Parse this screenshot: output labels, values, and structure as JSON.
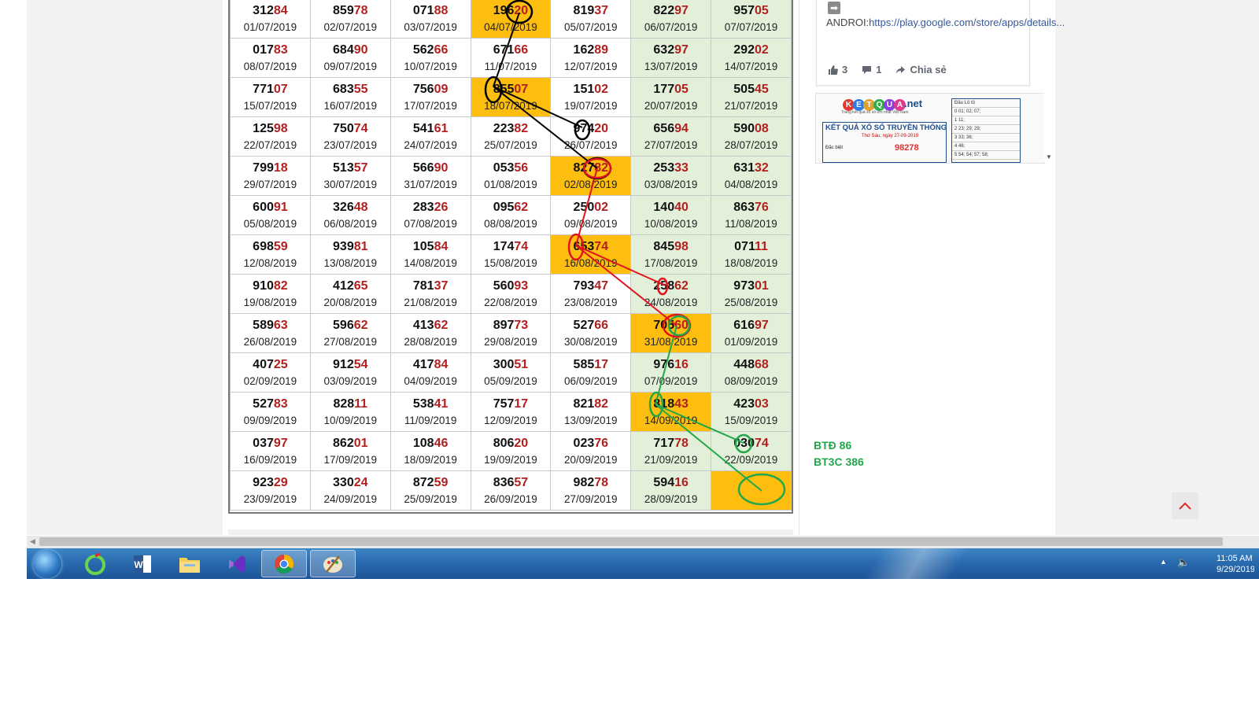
{
  "results": {
    "rows": [
      [
        {
          "head": "312",
          "tail": "84",
          "date": "01/07/2019"
        },
        {
          "head": "859",
          "tail": "78",
          "date": "02/07/2019"
        },
        {
          "head": "071",
          "tail": "88",
          "date": "03/07/2019"
        },
        {
          "head": "196",
          "tail": "20",
          "date": "04/07/2019"
        },
        {
          "head": "819",
          "tail": "37",
          "date": "05/07/2019"
        },
        {
          "head": "822",
          "tail": "97",
          "date": "06/07/2019"
        },
        {
          "head": "957",
          "tail": "05",
          "date": "07/07/2019"
        }
      ],
      [
        {
          "head": "017",
          "tail": "83",
          "date": "08/07/2019"
        },
        {
          "head": "684",
          "tail": "90",
          "date": "09/07/2019"
        },
        {
          "head": "562",
          "tail": "66",
          "date": "10/07/2019"
        },
        {
          "head": "671",
          "tail": "66",
          "date": "11/07/2019"
        },
        {
          "head": "162",
          "tail": "89",
          "date": "12/07/2019"
        },
        {
          "head": "632",
          "tail": "97",
          "date": "13/07/2019"
        },
        {
          "head": "292",
          "tail": "02",
          "date": "14/07/2019"
        }
      ],
      [
        {
          "head": "771",
          "tail": "07",
          "date": "15/07/2019"
        },
        {
          "head": "683",
          "tail": "55",
          "date": "16/07/2019"
        },
        {
          "head": "756",
          "tail": "09",
          "date": "17/07/2019"
        },
        {
          "head": "855",
          "tail": "07",
          "date": "18/07/2019"
        },
        {
          "head": "151",
          "tail": "02",
          "date": "19/07/2019"
        },
        {
          "head": "177",
          "tail": "05",
          "date": "20/07/2019"
        },
        {
          "head": "505",
          "tail": "45",
          "date": "21/07/2019"
        }
      ],
      [
        {
          "head": "125",
          "tail": "98",
          "date": "22/07/2019"
        },
        {
          "head": "750",
          "tail": "74",
          "date": "23/07/2019"
        },
        {
          "head": "541",
          "tail": "61",
          "date": "24/07/2019"
        },
        {
          "head": "223",
          "tail": "82",
          "date": "25/07/2019"
        },
        {
          "head": "974",
          "tail": "20",
          "date": "26/07/2019"
        },
        {
          "head": "656",
          "tail": "94",
          "date": "27/07/2019"
        },
        {
          "head": "590",
          "tail": "08",
          "date": "28/07/2019"
        }
      ],
      [
        {
          "head": "799",
          "tail": "18",
          "date": "29/07/2019"
        },
        {
          "head": "513",
          "tail": "57",
          "date": "30/07/2019"
        },
        {
          "head": "566",
          "tail": "90",
          "date": "31/07/2019"
        },
        {
          "head": "053",
          "tail": "56",
          "date": "01/08/2019"
        },
        {
          "head": "827",
          "tail": "82",
          "date": "02/08/2019"
        },
        {
          "head": "253",
          "tail": "33",
          "date": "03/08/2019"
        },
        {
          "head": "631",
          "tail": "32",
          "date": "04/08/2019"
        }
      ],
      [
        {
          "head": "600",
          "tail": "91",
          "date": "05/08/2019"
        },
        {
          "head": "326",
          "tail": "48",
          "date": "06/08/2019"
        },
        {
          "head": "283",
          "tail": "26",
          "date": "07/08/2019"
        },
        {
          "head": "095",
          "tail": "62",
          "date": "08/08/2019"
        },
        {
          "head": "250",
          "tail": "02",
          "date": "09/08/2019"
        },
        {
          "head": "140",
          "tail": "40",
          "date": "10/08/2019"
        },
        {
          "head": "863",
          "tail": "76",
          "date": "11/08/2019"
        }
      ],
      [
        {
          "head": "698",
          "tail": "59",
          "date": "12/08/2019"
        },
        {
          "head": "939",
          "tail": "81",
          "date": "13/08/2019"
        },
        {
          "head": "105",
          "tail": "84",
          "date": "14/08/2019"
        },
        {
          "head": "174",
          "tail": "74",
          "date": "15/08/2019"
        },
        {
          "head": "653",
          "tail": "74",
          "date": "16/08/2019"
        },
        {
          "head": "845",
          "tail": "98",
          "date": "17/08/2019"
        },
        {
          "head": "071",
          "tail": "11",
          "date": "18/08/2019"
        }
      ],
      [
        {
          "head": "910",
          "tail": "82",
          "date": "19/08/2019"
        },
        {
          "head": "412",
          "tail": "65",
          "date": "20/08/2019"
        },
        {
          "head": "781",
          "tail": "37",
          "date": "21/08/2019"
        },
        {
          "head": "560",
          "tail": "93",
          "date": "22/08/2019"
        },
        {
          "head": "793",
          "tail": "47",
          "date": "23/08/2019"
        },
        {
          "head": "258",
          "tail": "62",
          "date": "24/08/2019"
        },
        {
          "head": "973",
          "tail": "01",
          "date": "25/08/2019"
        }
      ],
      [
        {
          "head": "589",
          "tail": "63",
          "date": "26/08/2019"
        },
        {
          "head": "596",
          "tail": "62",
          "date": "27/08/2019"
        },
        {
          "head": "413",
          "tail": "62",
          "date": "28/08/2019"
        },
        {
          "head": "897",
          "tail": "73",
          "date": "29/08/2019"
        },
        {
          "head": "527",
          "tail": "66",
          "date": "30/08/2019"
        },
        {
          "head": "705",
          "tail": "60",
          "date": "31/08/2019"
        },
        {
          "head": "616",
          "tail": "97",
          "date": "01/09/2019"
        }
      ],
      [
        {
          "head": "407",
          "tail": "25",
          "date": "02/09/2019"
        },
        {
          "head": "912",
          "tail": "54",
          "date": "03/09/2019"
        },
        {
          "head": "417",
          "tail": "84",
          "date": "04/09/2019"
        },
        {
          "head": "300",
          "tail": "51",
          "date": "05/09/2019"
        },
        {
          "head": "585",
          "tail": "17",
          "date": "06/09/2019"
        },
        {
          "head": "976",
          "tail": "16",
          "date": "07/09/2019"
        },
        {
          "head": "448",
          "tail": "68",
          "date": "08/09/2019"
        }
      ],
      [
        {
          "head": "527",
          "tail": "83",
          "date": "09/09/2019"
        },
        {
          "head": "828",
          "tail": "11",
          "date": "10/09/2019"
        },
        {
          "head": "538",
          "tail": "41",
          "date": "11/09/2019"
        },
        {
          "head": "757",
          "tail": "17",
          "date": "12/09/2019"
        },
        {
          "head": "821",
          "tail": "82",
          "date": "13/09/2019"
        },
        {
          "head": "818",
          "tail": "43",
          "date": "14/09/2019"
        },
        {
          "head": "423",
          "tail": "03",
          "date": "15/09/2019"
        }
      ],
      [
        {
          "head": "037",
          "tail": "97",
          "date": "16/09/2019"
        },
        {
          "head": "862",
          "tail": "01",
          "date": "17/09/2019"
        },
        {
          "head": "108",
          "tail": "46",
          "date": "18/09/2019"
        },
        {
          "head": "806",
          "tail": "20",
          "date": "19/09/2019"
        },
        {
          "head": "023",
          "tail": "76",
          "date": "20/09/2019"
        },
        {
          "head": "717",
          "tail": "78",
          "date": "21/09/2019"
        },
        {
          "head": "030",
          "tail": "74",
          "date": "22/09/2019"
        }
      ],
      [
        {
          "head": "923",
          "tail": "29",
          "date": "23/09/2019"
        },
        {
          "head": "330",
          "tail": "24",
          "date": "24/09/2019"
        },
        {
          "head": "872",
          "tail": "59",
          "date": "25/09/2019"
        },
        {
          "head": "836",
          "tail": "57",
          "date": "26/09/2019"
        },
        {
          "head": "982",
          "tail": "78",
          "date": "27/09/2019"
        },
        {
          "head": "594",
          "tail": "16",
          "date": "28/09/2019"
        },
        {
          "head": "",
          "tail": "",
          "date": ""
        }
      ]
    ],
    "highlighted_cells": [
      [
        0,
        3
      ],
      [
        2,
        3
      ],
      [
        4,
        4
      ],
      [
        6,
        4
      ],
      [
        8,
        5
      ],
      [
        10,
        5
      ],
      [
        12,
        6
      ]
    ],
    "green_columns": [
      5,
      6
    ],
    "colors": {
      "green": "#e2f0d9",
      "orange": "#fdbe0f",
      "tail": "#b21f1f",
      "line_black": "#000000",
      "line_red": "#e0141e",
      "line_green": "#22a64b"
    }
  },
  "sidebar": {
    "post": {
      "prefix": "ANDROI:",
      "link": "https://play.google.com/store/apps/details...",
      "likes": "3",
      "comments": "1",
      "share_label": "Chia sẻ",
      "icons": [
        "arrow-right-icon",
        "thumbs-up-icon",
        "comment-icon",
        "share-icon"
      ]
    },
    "preview": {
      "logo_letters": [
        "K",
        "E",
        "T",
        "Q",
        "U",
        "A"
      ],
      "logo_suffix": ".net",
      "tagline": "Trang kết quả xổ số lớn nhất Việt Nam",
      "title": "KẾT QUẢ XỔ SỐ TRUYỀN THỐNG",
      "subtitle": "Thứ Sáu, ngày 27-09-2019",
      "db_label": "Đặc biệt",
      "db_value": "98278",
      "loto_header": "Đầu    Lô tô",
      "loto_rows": [
        "0  01; 02; 07;",
        "1  11;",
        "2  23; 29; 29;",
        "3  33; 36;",
        "4  46;",
        "5  54; 54; 57; 58;"
      ]
    },
    "note_lines": [
      "BTĐ 86",
      "BT3C 386"
    ]
  },
  "taskbar": {
    "apps": [
      "start-orb",
      "ccleaner-icon",
      "word-icon",
      "file-explorer-icon",
      "visual-studio-icon",
      "chrome-icon",
      "paint-icon"
    ],
    "active_app": "chrome-icon",
    "clock_time": "11:05 AM",
    "clock_date": "9/29/2019"
  }
}
